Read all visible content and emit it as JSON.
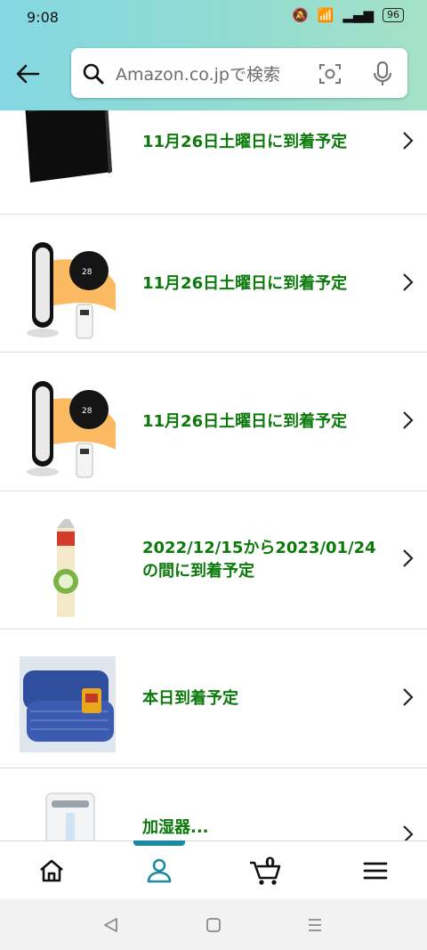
{
  "status_bar": {
    "time": "9:08",
    "battery": "96"
  },
  "search": {
    "placeholder": "Amazon.co.jpで検索"
  },
  "orders": [
    {
      "text": "11月26日土曜日に到着予定",
      "image": "black-wallet"
    },
    {
      "text": "11月26日土曜日に到着予定",
      "image": "tower-heater-with-remote"
    },
    {
      "text": "11月26日土曜日に到着予定",
      "image": "tower-heater-with-remote"
    },
    {
      "text": "2022/12/15から2023/01/24の間に到着予定",
      "image": "juice-carton"
    },
    {
      "text": "本日到着予定",
      "image": "blue-pillows"
    },
    {
      "text": "加湿器...",
      "image": "humidifier"
    }
  ],
  "bottom_nav": {
    "items": [
      "home-icon",
      "account-icon",
      "cart-icon",
      "menu-icon"
    ],
    "active": "account-icon",
    "cart_count": "0"
  },
  "colors": {
    "accent": "#1b8aa0",
    "delivery_text": "#0b7a0b"
  }
}
